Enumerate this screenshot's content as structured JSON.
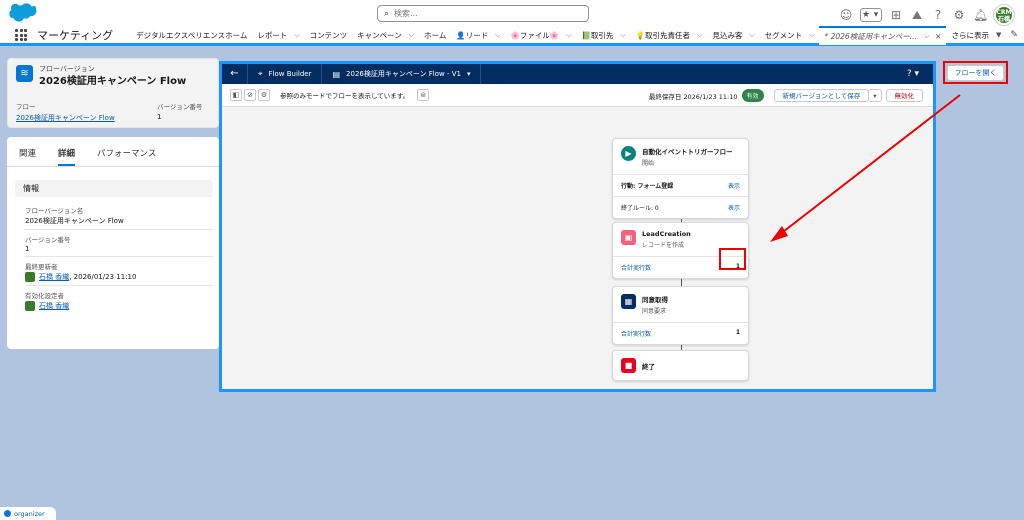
{
  "header": {
    "search_placeholder": "検索...",
    "avatar_text": "CRM\n石橋"
  },
  "nav": {
    "app_name": "マーケティング",
    "items": [
      {
        "label": "デジタルエクスペリエンスホーム",
        "chevron": false
      },
      {
        "label": "レポート",
        "chevron": true
      },
      {
        "label": "コンテンツ",
        "chevron": false
      },
      {
        "label": "キャンペーン",
        "chevron": true
      },
      {
        "label": "ホーム",
        "chevron": false
      },
      {
        "label": "👤リード",
        "chevron": true
      },
      {
        "label": "🌸ファイル🌸",
        "chevron": true
      },
      {
        "label": "📗取引先",
        "chevron": true
      },
      {
        "label": "💡取引先責任者",
        "chevron": true
      },
      {
        "label": "見込み客",
        "chevron": true
      },
      {
        "label": "セグメント",
        "chevron": true
      }
    ],
    "active_tab": "* 2026検証用キャンペー...",
    "more": "さらに表示"
  },
  "record": {
    "type_label": "フローバージョン",
    "title": "2026検証用キャンペーン Flow",
    "flow_label": "フロー",
    "flow_value": "2026検証用キャンペーン Flow",
    "version_label": "バージョン番号",
    "version_value": "1",
    "tabs": [
      "関連",
      "詳細",
      "パフォーマンス"
    ],
    "section_title": "情報",
    "fields": [
      {
        "label": "フローバージョン名",
        "value": "2026検証用キャンペーン Flow"
      },
      {
        "label": "バージョン番号",
        "value": "1"
      },
      {
        "label": "最終更新者",
        "user": "石橋 香織",
        "extra": ", 2026/01/23 11:10"
      },
      {
        "label": "有効化設定者",
        "user": "石橋 香織",
        "extra": ""
      }
    ]
  },
  "flow_builder": {
    "app_label": "Flow Builder",
    "flow_name": "2026検証用キャンペーン Flow - V1",
    "help": "? ▾",
    "readonly_msg": "参照のみモードでフローを表示しています。",
    "last_saved": "最終保存日 2026/1/23 11:10",
    "status_badge": "有効",
    "save_new_version": "新規バージョンとして保存",
    "deactivate": "無効化",
    "nodes": {
      "start": {
        "title": "自動化イベントトリガーフロー",
        "subtitle": "開始",
        "action_label": "行動: フォーム登録",
        "action_link": "表示",
        "exit_label": "終了ルール: 0",
        "exit_link": "表示"
      },
      "lead": {
        "title": "LeadCreation",
        "subtitle": "レコードを作成",
        "count_label": "合計実行数",
        "count": "1"
      },
      "consent": {
        "title": "同意取得",
        "subtitle": "同意要求",
        "count_label": "合計実行数",
        "count": "1"
      },
      "end": {
        "title": "終了"
      }
    }
  },
  "open_flow_button": "フローを開く",
  "footer": "organizer",
  "colors": {
    "brand": "#0176d3",
    "nav_dark": "#032d60",
    "highlight": "#e00000",
    "frame": "#1b96ff"
  }
}
